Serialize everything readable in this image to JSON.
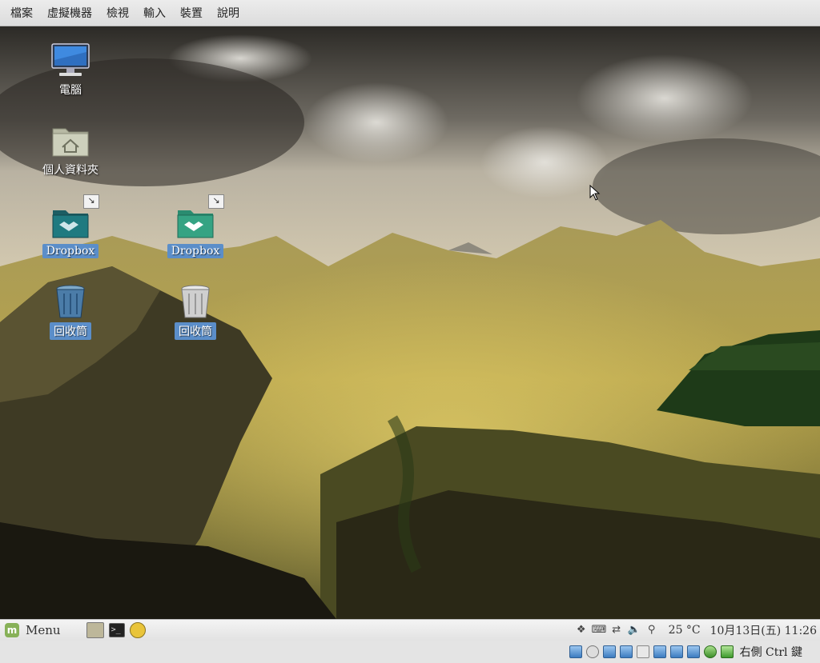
{
  "host_menu": [
    "檔案",
    "虛擬機器",
    "檢視",
    "輸入",
    "裝置",
    "說明"
  ],
  "desktop": {
    "icons": [
      {
        "label": "電腦",
        "icon": "computer-icon"
      },
      {
        "label": "個人資料夾",
        "icon": "home-folder-icon"
      },
      {
        "label": "Dropbox",
        "icon": "dropbox-folder-icon",
        "selected": true,
        "link": true
      },
      {
        "label": "Dropbox",
        "icon": "dropbox-folder-icon",
        "selected": true,
        "link": true
      },
      {
        "label": "回收筒",
        "icon": "trash-icon",
        "selected": true
      },
      {
        "label": "回收筒",
        "icon": "trash-icon",
        "selected": true
      }
    ]
  },
  "panel": {
    "menu_label": "Menu",
    "launchers": [
      "files-icon",
      "terminal-icon",
      "update-manager-icon"
    ],
    "tray_icons": [
      "dropbox-tray-icon",
      "keyboard-icon",
      "network-icon",
      "volume-icon",
      "search-tray-icon"
    ],
    "weather": "25 °C",
    "clock": "10月13日(五) 11:26"
  },
  "vb_status": {
    "icons": [
      "hard-disk-icon",
      "optical-drive-icon",
      "network-status-icon",
      "usb-icon",
      "shared-folder-icon",
      "display-icon",
      "video-capture-icon",
      "cpu-icon",
      "mouse-integration-icon",
      "host-key-arrow-icon"
    ],
    "host_key": "右側 Ctrl 鍵"
  },
  "colors": {
    "selection": "#5b8ec9",
    "mint_green": "#87b158",
    "dropbox_teal": "#1f7a80"
  }
}
